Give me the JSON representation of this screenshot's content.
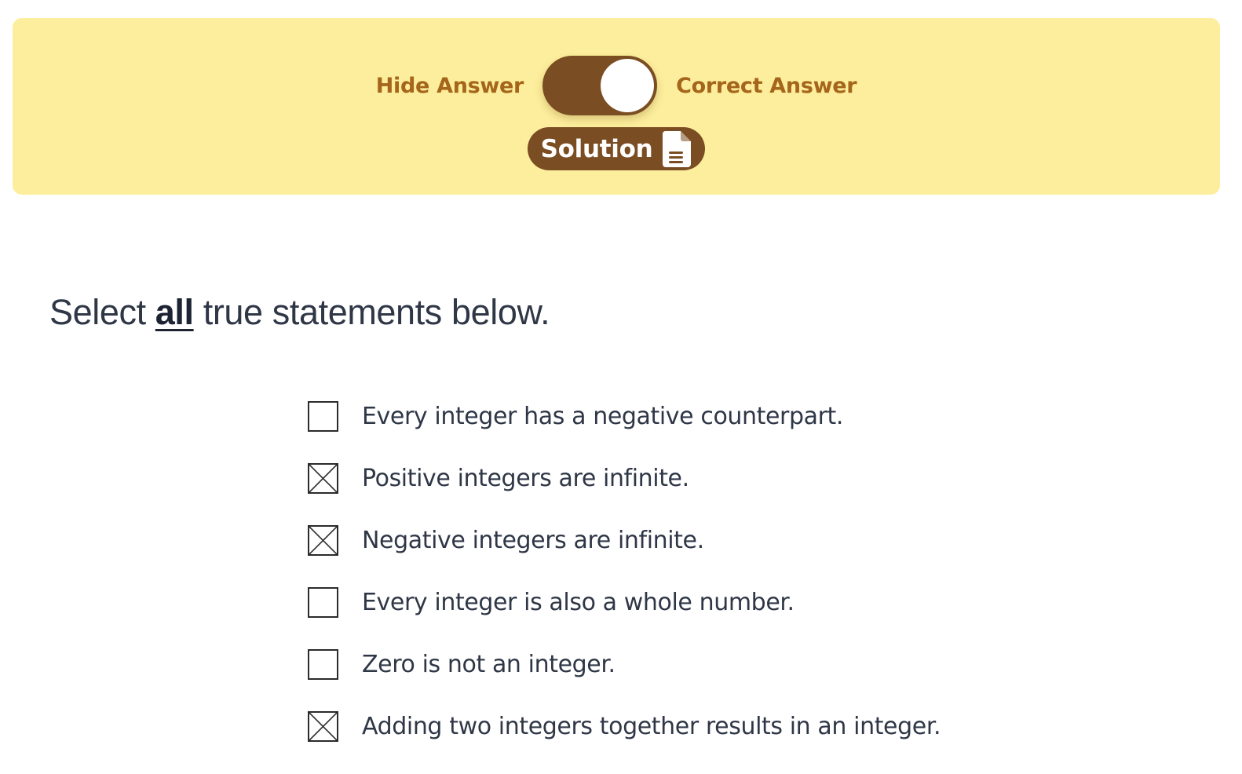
{
  "colors": {
    "panel_bg": "#fcee9c",
    "label_color": "#a5651b",
    "brown": "#7b4d23",
    "text": "#2f3747"
  },
  "answer_panel": {
    "hide_label": "Hide Answer",
    "correct_label": "Correct Answer",
    "toggle_state": "correct-answer",
    "solution_label": "Solution",
    "solution_icon": "document-icon"
  },
  "question": {
    "prefix": "Select ",
    "emphasis": "all",
    "suffix": " true statements below."
  },
  "options": [
    {
      "text": "Every integer has a negative counterpart.",
      "checked": false
    },
    {
      "text": "Positive integers are infinite.",
      "checked": true
    },
    {
      "text": "Negative integers are infinite.",
      "checked": true
    },
    {
      "text": "Every integer is also a whole number.",
      "checked": false
    },
    {
      "text": "Zero is not an integer.",
      "checked": false
    },
    {
      "text": "Adding two integers together results in an integer.",
      "checked": true
    }
  ]
}
